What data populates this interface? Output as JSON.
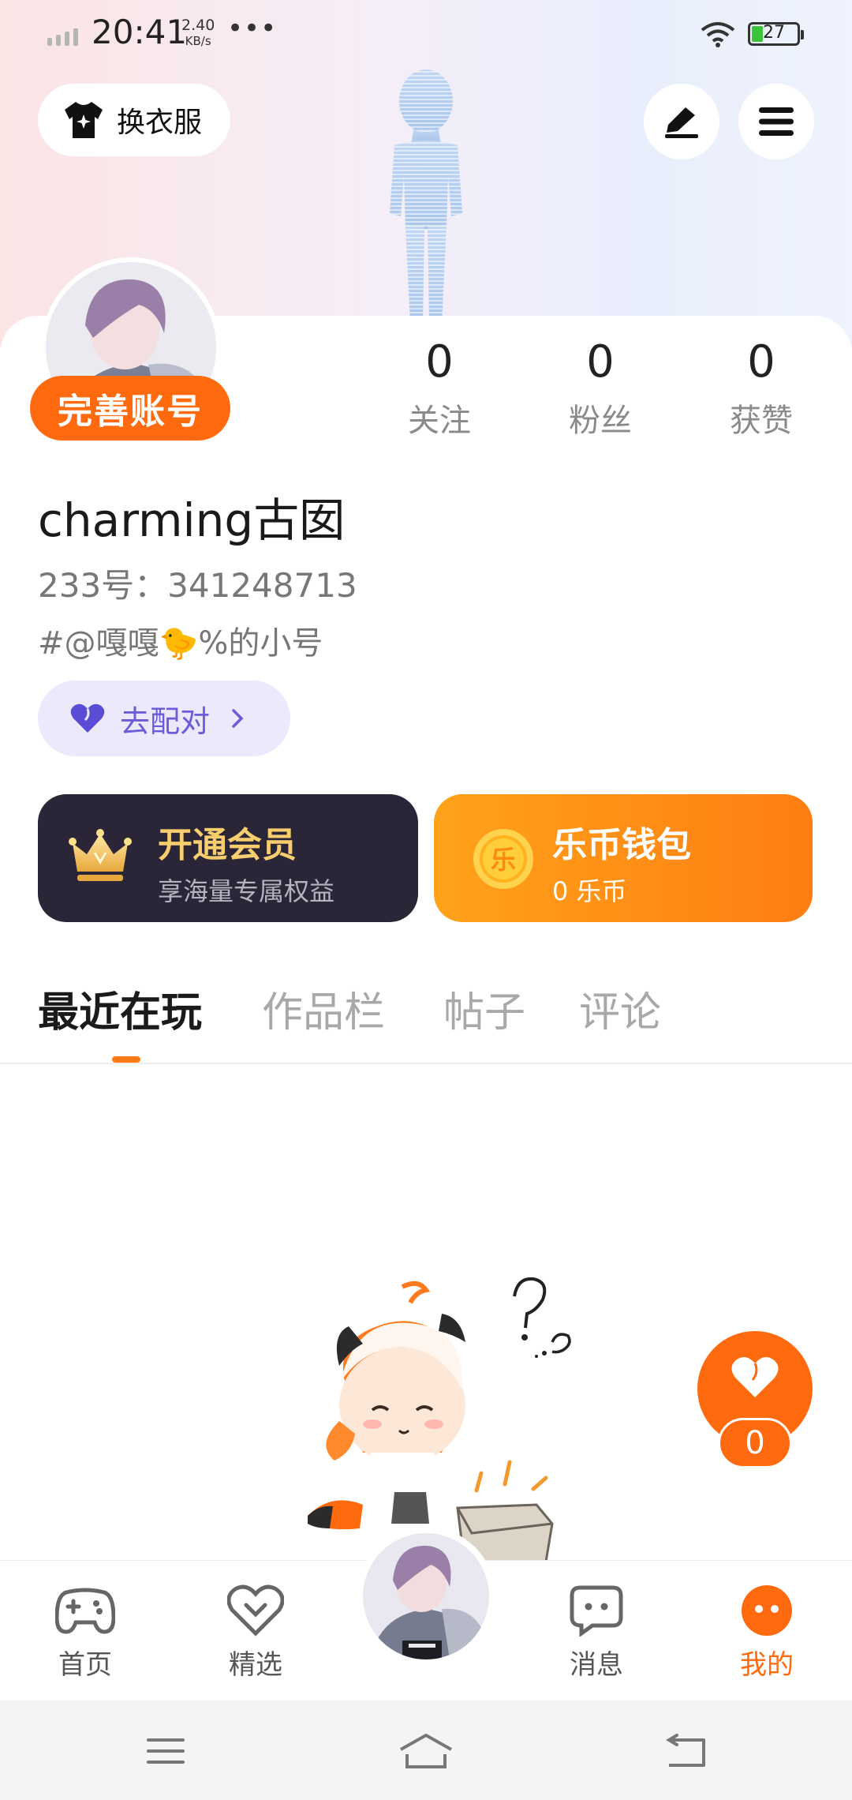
{
  "status_bar": {
    "time": "20:41",
    "net_speed_value": "2.40",
    "net_speed_unit": "KB/s",
    "more": "•••",
    "battery": "27"
  },
  "header": {
    "dress_label": "换衣服",
    "edit_icon": "pencil-icon",
    "menu_icon": "hamburger-icon"
  },
  "profile": {
    "complete_label": "完善账号",
    "stats": [
      {
        "value": "0",
        "label": "关注"
      },
      {
        "value": "0",
        "label": "粉丝"
      },
      {
        "value": "0",
        "label": "获赞"
      }
    ],
    "username": "charming古囡",
    "user_id": "233号：341248713",
    "signature": "#@嘎嘎🐤%的小号",
    "match_label": "去配对"
  },
  "cards": {
    "vip_title": "开通会员",
    "vip_sub": "享海量专属权益",
    "coin_title": "乐币钱包",
    "coin_sub": "0 乐币",
    "coin_glyph": "乐"
  },
  "tabs": [
    {
      "label": "最近在玩",
      "active": true
    },
    {
      "label": "作品栏",
      "active": false
    },
    {
      "label": "帖子",
      "active": false
    },
    {
      "label": "评论",
      "active": false
    }
  ],
  "fab": {
    "count": "0",
    "icon": "heart-icon"
  },
  "bottom_nav": [
    {
      "label": "首页",
      "icon": "gamepad-icon",
      "active": false
    },
    {
      "label": "精选",
      "icon": "heart-badge-icon",
      "active": false
    },
    {
      "label": "消息",
      "icon": "chat-icon",
      "active": false
    },
    {
      "label": "我的",
      "icon": "profile-face-icon",
      "active": true
    }
  ],
  "colors": {
    "accent": "#ff6a0f",
    "vip_bg": "#2a2638",
    "vip_gold": "#f7cd6e",
    "match_purple": "#6b5cd9",
    "match_bg": "#ece9fd"
  }
}
